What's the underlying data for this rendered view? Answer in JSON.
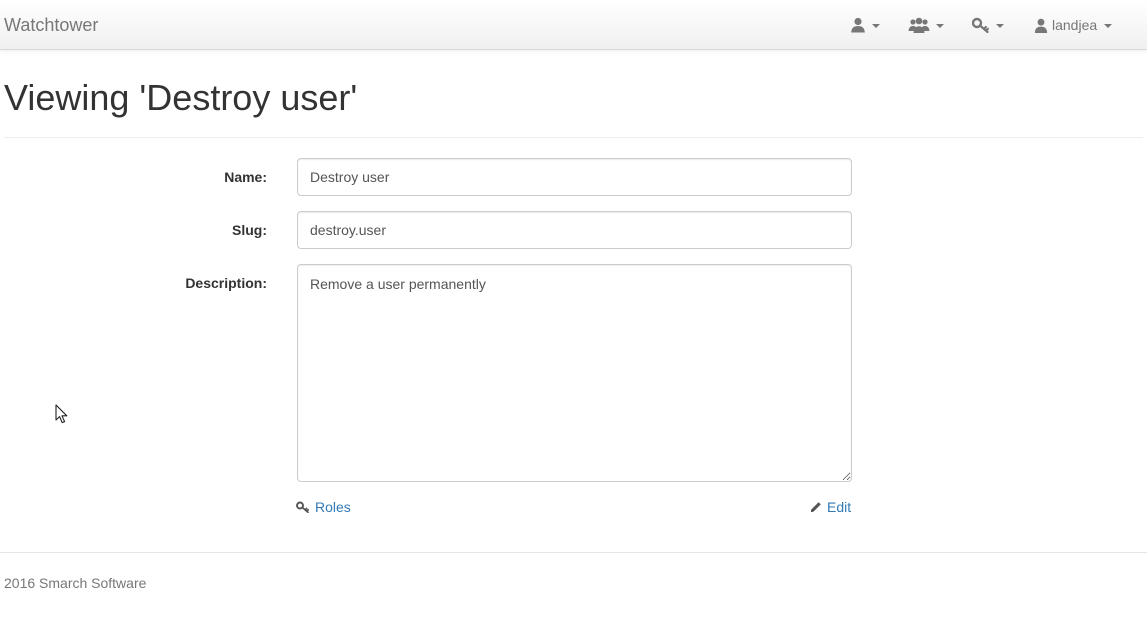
{
  "navbar": {
    "brand": "Watchtower",
    "user_menu_icon": "user-icon",
    "groups_menu_icon": "users-icon",
    "permissions_menu_icon": "key-icon",
    "account": {
      "icon": "user-icon",
      "username": "landjea"
    }
  },
  "page": {
    "title": "Viewing 'Destroy user'"
  },
  "form": {
    "name": {
      "label": "Name:",
      "value": "Destroy user"
    },
    "slug": {
      "label": "Slug:",
      "value": "destroy.user"
    },
    "description": {
      "label": "Description:",
      "value": "Remove a user permanently"
    }
  },
  "actions": {
    "roles": {
      "label": "Roles",
      "icon": "key-icon"
    },
    "edit": {
      "label": "Edit",
      "icon": "pencil-icon"
    }
  },
  "footer": {
    "text": "2016 Smarch Software"
  },
  "colors": {
    "link": "#337ab7",
    "muted": "#777777",
    "text": "#333333"
  }
}
